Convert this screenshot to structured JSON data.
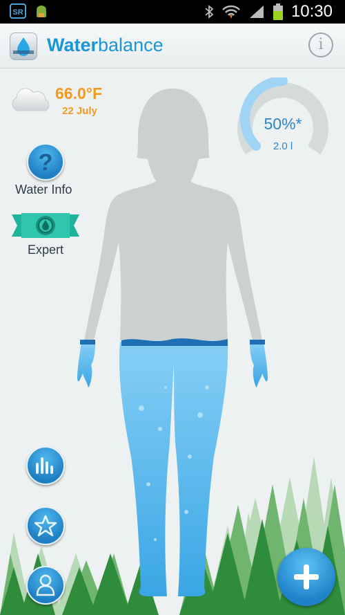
{
  "status_bar": {
    "left_icons": [
      "sr-icon",
      "android-icon"
    ],
    "sr_label": "SR",
    "right_icons": [
      "bluetooth-icon",
      "wifi-icon",
      "signal-icon",
      "battery-icon"
    ],
    "time": "10:30"
  },
  "header": {
    "title_part1": "Water",
    "title_part2": "balance",
    "info_label": "i"
  },
  "weather": {
    "icon": "cloud-icon",
    "temperature": "66.0°F",
    "date": "22 July"
  },
  "gauge": {
    "percent_label": "50%*",
    "volume_label": "2.0 l",
    "fill_fraction": 0.5
  },
  "left_menu": {
    "water_info_label": "Water Info",
    "water_info_icon": "question-icon",
    "expert_label": "Expert",
    "expert_icon": "drop-badge-icon"
  },
  "bottom_buttons": {
    "stats_icon": "bar-chart-icon",
    "favorites_icon": "star-icon",
    "profile_icon": "person-icon",
    "add_icon": "plus-icon"
  },
  "body": {
    "water_level_fraction": 0.5
  },
  "colors": {
    "accent": "#1a96d6",
    "weather": "#f39a1e",
    "water": "#4fb5ee",
    "silhouette": "#cbd0d1",
    "tree_dark": "#2e8a3b",
    "tree_light": "#a9cfa9"
  }
}
